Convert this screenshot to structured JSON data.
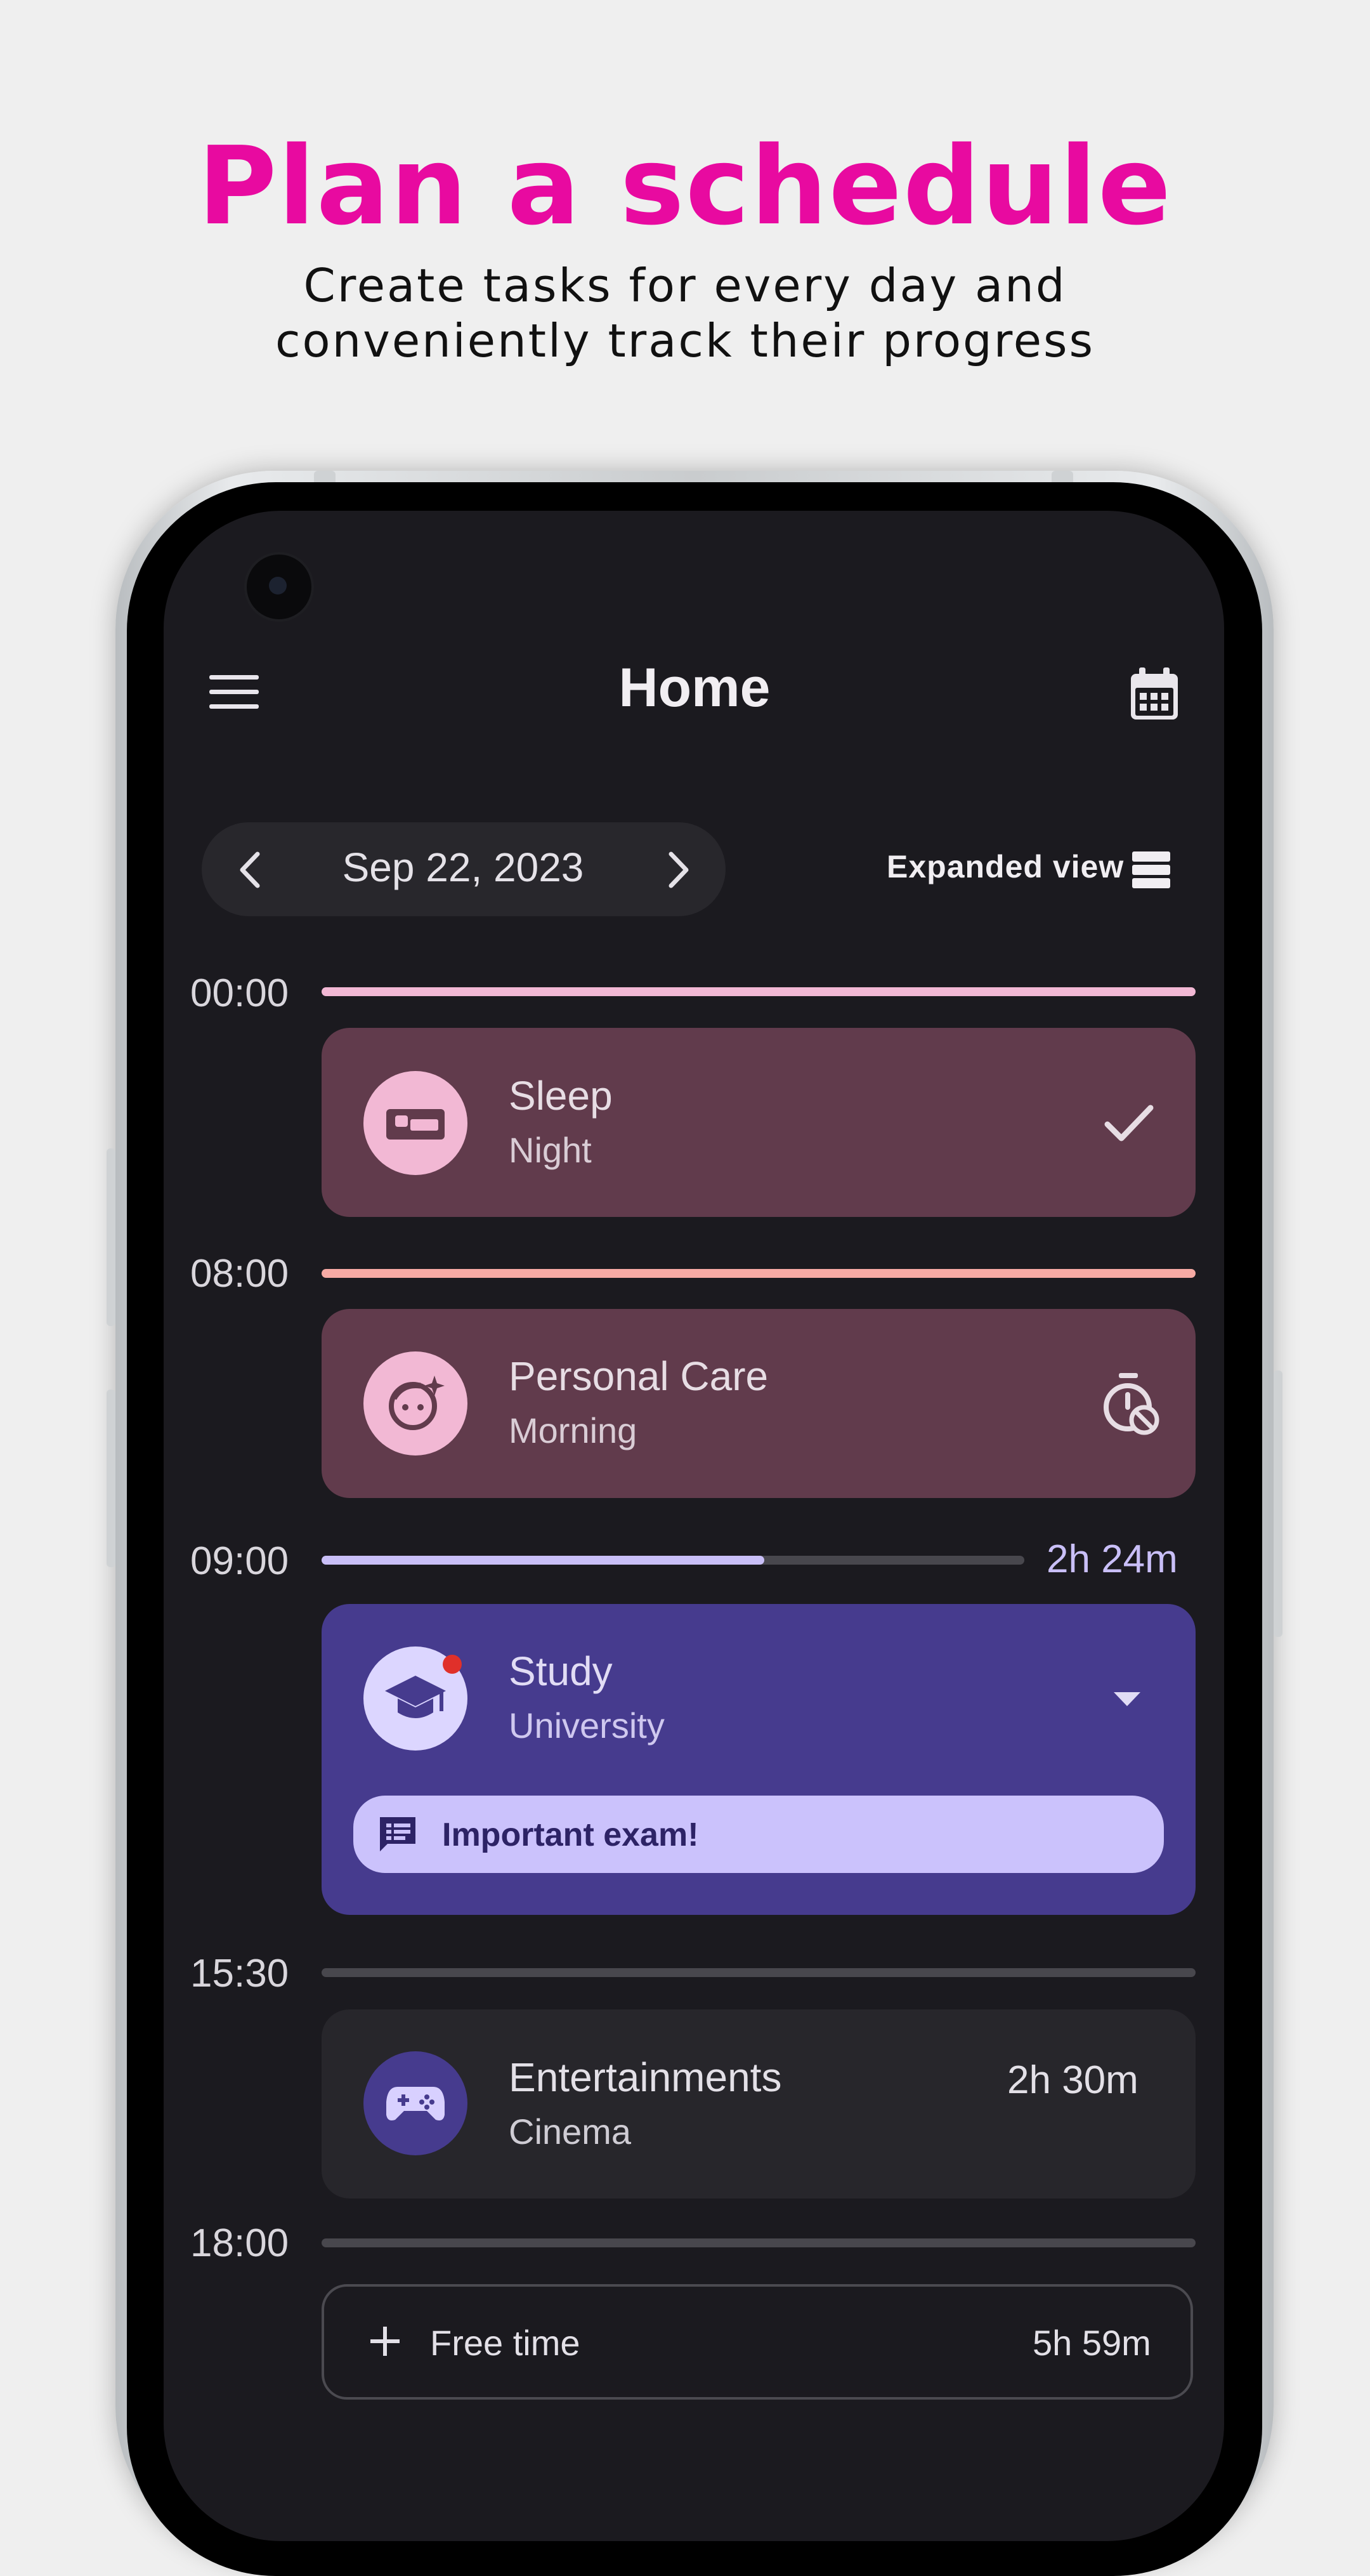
{
  "marketing": {
    "headline": "Plan a schedule",
    "subline1": "Create tasks for every day and",
    "subline2": "conveniently track their progress",
    "accent": "#e80aa0"
  },
  "app": {
    "title": "Home",
    "menu_icon": "hamburger-menu-icon",
    "calendar_icon": "calendar-icon",
    "date": "Sep 22, 2023",
    "view_mode_label": "Expanded view"
  },
  "timeline": {
    "slots": [
      {
        "time": "00:00",
        "line_color": "#f2b8d4"
      },
      {
        "time": "08:00",
        "line_color": "#f7aaa4"
      },
      {
        "time": "09:00",
        "progress": 0.63,
        "remaining": "2h 24m",
        "line_color": "#c9bff7"
      },
      {
        "time": "15:30",
        "line_color": "#48474d"
      },
      {
        "time": "18:00",
        "line_color": "#48474d"
      }
    ]
  },
  "tasks": [
    {
      "title": "Sleep",
      "subtitle": "Night",
      "icon": "bed-icon",
      "status_icon": "check-icon",
      "color": "#613b4c"
    },
    {
      "title": "Personal Care",
      "subtitle": "Morning",
      "icon": "face-retouching-icon",
      "status_icon": "timer-off-icon",
      "color": "#613b4c"
    },
    {
      "title": "Study",
      "subtitle": "University",
      "icon": "graduation-cap-icon",
      "status_icon": "dropdown-arrow-icon",
      "note": "Important exam!",
      "color": "#463b8e"
    },
    {
      "title": "Entertainments",
      "subtitle": "Cinema",
      "icon": "gamepad-icon",
      "duration": "2h 30m",
      "color": "#27262b"
    }
  ],
  "free_time": {
    "label": "Free time",
    "duration": "5h 59m"
  }
}
